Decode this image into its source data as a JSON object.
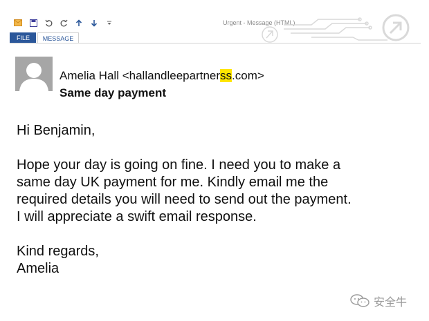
{
  "window": {
    "title": "Urgent - Message (HTML)"
  },
  "tabs": [
    {
      "label": "FILE"
    },
    {
      "label": "MESSAGE"
    }
  ],
  "email": {
    "sender_name": "Amelia Hall",
    "sender_email_prefix": "<hallandleepartner",
    "sender_email_highlight": "ss",
    "sender_email_suffix": ".com>",
    "subject": "Same day payment",
    "greeting": "Hi Benjamin,",
    "body_lines": [
      "Hope your day is going on fine. I need you to make a",
      "same day UK payment for me. Kindly email me the",
      "required details you will need to send out the payment.",
      "I will appreciate a swift email response."
    ],
    "closing": "Kind regards,",
    "signature": "Amelia"
  },
  "watermark": {
    "text": "安全牛"
  },
  "colors": {
    "accent": "#2b579a",
    "highlight": "#ffe600",
    "avatar_bg": "#a6a6a6"
  },
  "icons": [
    "mail-icon",
    "save-icon",
    "undo-icon",
    "redo-icon",
    "up-arrow-icon",
    "down-arrow-icon",
    "customize-icon"
  ]
}
